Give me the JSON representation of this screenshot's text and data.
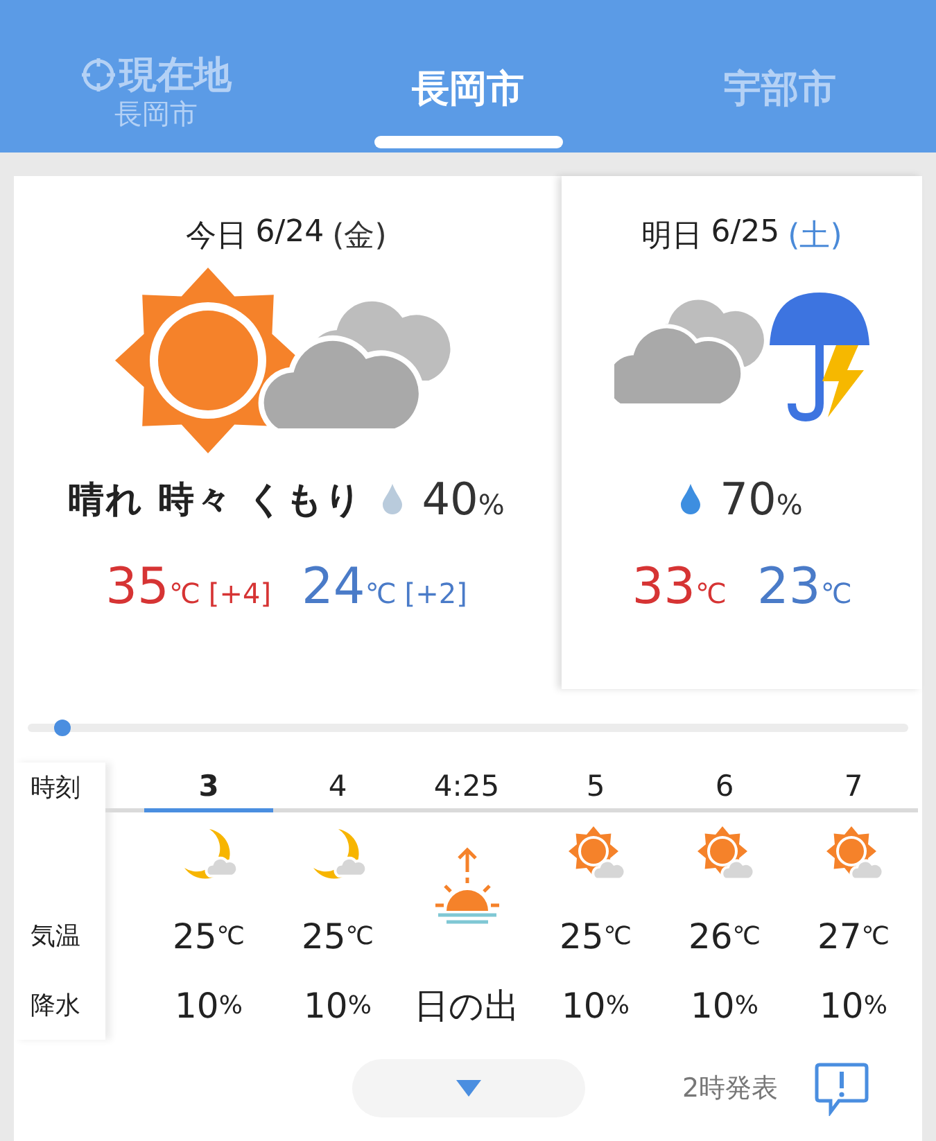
{
  "tabs": [
    {
      "label": "現在地",
      "sublabel": "長岡市",
      "kind": "location",
      "selected": false
    },
    {
      "label": "長岡市",
      "kind": "city",
      "selected": true
    },
    {
      "label": "宇部市",
      "kind": "city",
      "selected": false
    }
  ],
  "days": [
    {
      "label": "今日",
      "date": "6/24",
      "weekday": "(金)",
      "saturday": false,
      "kind": "sun_cloud",
      "condition": "晴れ 時々 くもり",
      "color": "#b9cbdc",
      "precip": {
        "value": "40",
        "unit": "%"
      },
      "high": {
        "value": "35",
        "unit": "℃",
        "diff": "[+4]"
      },
      "low": {
        "value": "24",
        "unit": "℃",
        "diff": "[+2]"
      }
    },
    {
      "label": "明日",
      "date": "6/25",
      "weekday": "(土)",
      "saturday": true,
      "kind": "cloud_thunder",
      "color": "#3d8ee0",
      "precip": {
        "value": "70",
        "unit": "%"
      },
      "high": {
        "value": "33",
        "unit": "℃"
      },
      "low": {
        "value": "23",
        "unit": "℃"
      }
    }
  ],
  "timeline": {
    "level": 0.04
  },
  "hourly": {
    "labels": {
      "time": "時刻",
      "temp": "気温",
      "precip": "降水"
    },
    "hours": [
      {
        "kind": "moon_cloud",
        "time": "3",
        "selected": true,
        "temp": "25",
        "unit": "℃",
        "precip": "10",
        "precip_unit": "%"
      },
      {
        "kind": "moon_cloud",
        "time": "4",
        "selected": false,
        "temp": "25",
        "unit": "℃",
        "precip": "10",
        "precip_unit": "%"
      },
      {
        "kind": "sunrise",
        "time": "4:25",
        "selected": false,
        "note": "日の出"
      },
      {
        "kind": "sun_cloud",
        "time": "5",
        "selected": false,
        "temp": "25",
        "unit": "℃",
        "precip": "10",
        "precip_unit": "%"
      },
      {
        "kind": "sun_cloud",
        "time": "6",
        "selected": false,
        "temp": "26",
        "unit": "℃",
        "precip": "10",
        "precip_unit": "%"
      },
      {
        "kind": "sun_cloud",
        "time": "7",
        "selected": false,
        "temp": "27",
        "unit": "℃",
        "precip": "10",
        "precip_unit": "%"
      }
    ]
  },
  "footer": {
    "issued": "2時発表"
  }
}
